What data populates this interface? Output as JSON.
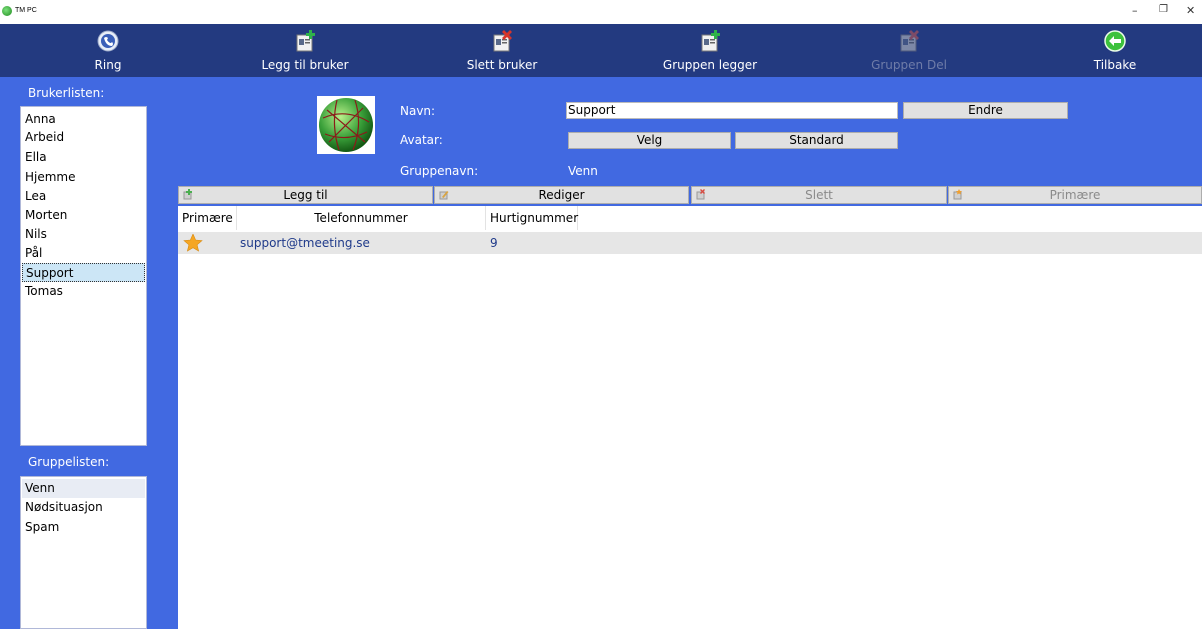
{
  "window": {
    "title": "TM PC",
    "controls": {
      "minimize": "–",
      "restore": "❐",
      "close": "✕"
    }
  },
  "toolbar": {
    "items": [
      {
        "label": "Ring",
        "icon": "phone-globe-icon",
        "enabled": true
      },
      {
        "label": "Legg til bruker",
        "icon": "add-contact-icon",
        "enabled": true
      },
      {
        "label": "Slett bruker",
        "icon": "delete-contact-icon",
        "enabled": true
      },
      {
        "label": "Gruppen legger",
        "icon": "add-group-icon",
        "enabled": true
      },
      {
        "label": "Gruppen Del",
        "icon": "delete-group-icon",
        "enabled": false
      },
      {
        "label": "Tilbake",
        "icon": "back-arrow-icon",
        "enabled": true
      }
    ]
  },
  "sidebar": {
    "user_list_label": "Brukerlisten:",
    "users": [
      "Anna",
      "Arbeid",
      "Ella",
      "Hjemme",
      "Lea",
      "Morten",
      "Nils",
      "Pål",
      "Support",
      "Tomas"
    ],
    "selected_user": "Support",
    "group_list_label": "Gruppelisten:",
    "groups": [
      "Venn",
      "Nødsituasjon",
      "Spam"
    ],
    "selected_group": "Venn"
  },
  "details": {
    "name_label": "Navn:",
    "name_value": "Support",
    "change_button": "Endre",
    "avatar_label": "Avatar:",
    "choose_button": "Velg",
    "default_button": "Standard",
    "group_name_label": "Gruppenavn:",
    "group_name_value": "Venn"
  },
  "actions": {
    "add": "Legg til",
    "edit": "Rediger",
    "delete": "Slett",
    "primary": "Primære"
  },
  "table": {
    "columns": [
      "Primære",
      "Telefonnummer",
      "Hurtignummer"
    ],
    "rows": [
      {
        "primary": true,
        "phone": "support@tmeeting.se",
        "speed_dial": "9"
      }
    ]
  },
  "colors": {
    "toolbar_bg": "#233a80",
    "body_bg": "#4169e1",
    "star": "#f5a623"
  }
}
